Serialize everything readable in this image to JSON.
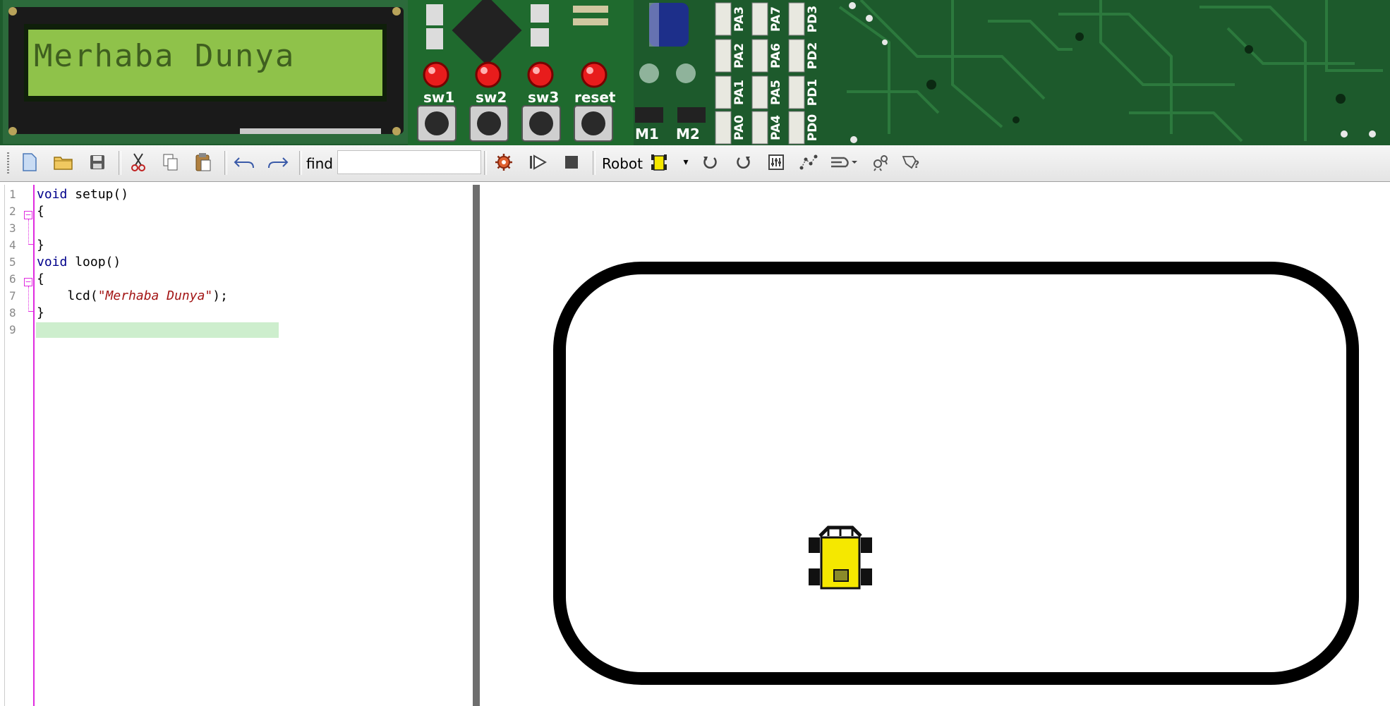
{
  "board": {
    "lcd_text": "Merhaba Dunya",
    "buttons": [
      "sw1",
      "sw2",
      "sw3",
      "reset"
    ],
    "motors": [
      "M1",
      "M2"
    ],
    "pins": [
      [
        "PA3",
        "PA7",
        "PD3"
      ],
      [
        "PA2",
        "PA6",
        "PD2"
      ],
      [
        "PA1",
        "PA5",
        "PD1"
      ],
      [
        "PA0",
        "PA4",
        "PD0"
      ]
    ]
  },
  "toolbar": {
    "find_label": "find",
    "find_value": "",
    "robot_label": "Robot",
    "icons": [
      "new-file-icon",
      "open-folder-icon",
      "save-icon",
      "cut-icon",
      "copy-icon",
      "paste-icon",
      "undo-icon",
      "redo-icon",
      "compile-gear-icon",
      "run-icon",
      "stop-icon",
      "robot-select-icon",
      "rotate-left-icon",
      "rotate-right-icon",
      "sensor-panel-icon",
      "path-icon",
      "track-select-icon",
      "settings-robot-icon",
      "debug-icon"
    ]
  },
  "editor": {
    "line_numbers": [
      "1",
      "2",
      "3",
      "4",
      "5",
      "6",
      "7",
      "8",
      "9"
    ],
    "lines": [
      {
        "kw": "void",
        "rest": " setup()"
      },
      {
        "kw": "",
        "rest": "{"
      },
      {
        "kw": "",
        "rest": ""
      },
      {
        "kw": "",
        "rest": "}"
      },
      {
        "kw": "void",
        "rest": " loop()"
      },
      {
        "kw": "",
        "rest": "{"
      },
      {
        "kw": "",
        "rest": "    lcd(",
        "str": "\"Merhaba Dunya\"",
        "tail": ");"
      },
      {
        "kw": "",
        "rest": "}"
      },
      {
        "kw": "",
        "rest": ""
      }
    ]
  },
  "colors": {
    "pcb": "#1d5a2c",
    "lcd_bg": "#8fc24a",
    "button_led": "#e81c1c",
    "robot_body": "#f5e800",
    "track": "#000000",
    "keyword": "#00008b",
    "string": "#a31515",
    "fold_line": "#e02ae0",
    "current_line": "#cdeecd"
  }
}
